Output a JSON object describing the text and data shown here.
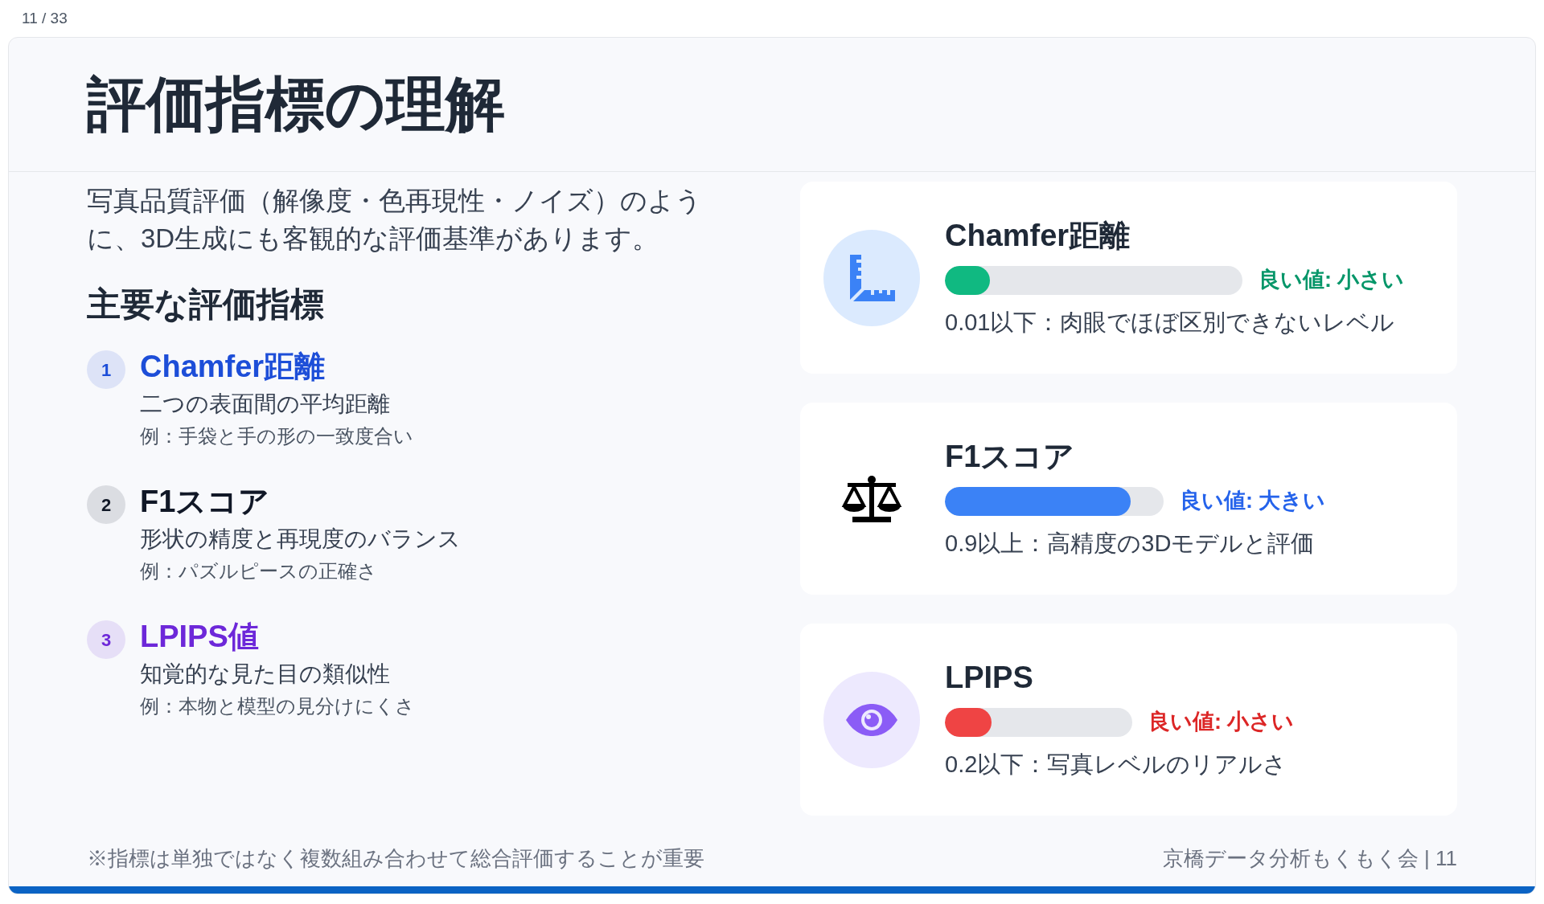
{
  "page_counter": "11 / 33",
  "slide": {
    "title": "評価指標の理解",
    "intro": "写真品質評価（解像度・色再現性・ノイズ）のように、3D生成にも客観的な評価基準があります。",
    "list_heading": "主要な評価指標",
    "metrics": [
      {
        "number": "1",
        "title": "Chamfer距離",
        "color": "#1d4ed8",
        "description": "二つの表面間の平均距離",
        "example": "例：手袋と手の形の一致度合い"
      },
      {
        "number": "2",
        "title": "F1スコア",
        "color": "#111827",
        "description": "形状の精度と再現度のバランス",
        "example": "例：パズルピースの正確さ"
      },
      {
        "number": "3",
        "title": "LPIPS値",
        "color": "#6d28d9",
        "description": "知覚的な見た目の類似性",
        "example": "例：本物と模型の見分けにくさ"
      }
    ],
    "cards": [
      {
        "kind": "ruler",
        "title": "Chamfer距離",
        "level": 0.15,
        "color": "#10b981",
        "good_value": "良い値: 小さい",
        "threshold": "0.01以下：肉眼でほぼ区別できないレベル"
      },
      {
        "kind": "scale",
        "title": "F1スコア",
        "level": 0.85,
        "color": "#3b82f6",
        "good_value": "良い値: 大きい",
        "threshold": "0.9以上：高精度の3Dモデルと評価"
      },
      {
        "kind": "eye",
        "title": "LPIPS",
        "level": 0.25,
        "color": "#ef4444",
        "good_value": "良い値: 小さい",
        "threshold": "0.2以下：写真レベルのリアルさ"
      }
    ],
    "footnote": "※指標は単独ではなく複数組み合わせて総合評価することが重要",
    "footer": "京橋データ分析もくもく会 | 11"
  }
}
